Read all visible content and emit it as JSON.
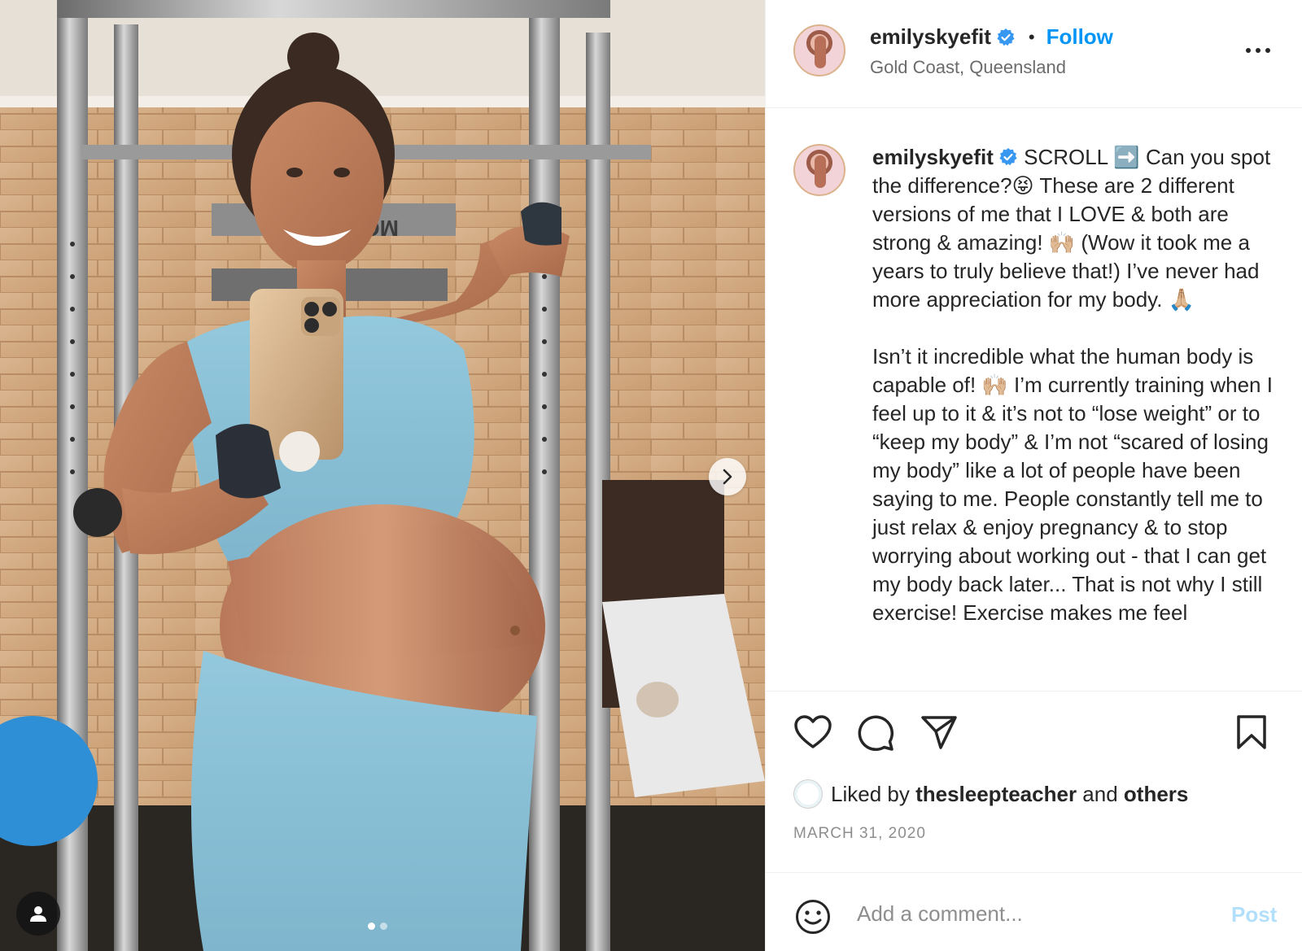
{
  "post": {
    "username": "emilyskyefit",
    "follow_label": "Follow",
    "separator": "•",
    "location": "Gold Coast, Queensland",
    "caption_username": "emilyskyefit",
    "caption": " SCROLL ➡️ Can you spot the difference?😝 These are 2 different versions of me that I LOVE & both are strong & amazing! 🙌🏼 (Wow it took me a years to truly believe that!) I’ve never had more appreciation for my body. 🙏🏼\n\nIsn’t it incredible what the human body is capable of! 🙌🏼 I’m currently training when I feel up to it & it’s not to “lose weight” or to “keep my body” & I’m not “scared of losing my body” like a lot of people have been saying to me. People constantly tell me to just relax & enjoy pregnancy & to stop worrying about working out - that I can get my body back later... That is not why I still exercise! Exercise makes me feel",
    "liked_by_prefix": "Liked by",
    "liked_by_user": "thesleepteacher",
    "liked_by_and": "and",
    "liked_by_others": "others",
    "date": "MARCH 31, 2020",
    "comment_placeholder": "Add a comment...",
    "post_label": "Post"
  },
  "media": {
    "carousel_count": 2,
    "carousel_active_index": 0,
    "equipment_brand_text": "MO"
  },
  "icons": {
    "verified": "verified-badge-icon",
    "more": "more-options-icon",
    "like": "heart-icon",
    "comment": "comment-icon",
    "share": "send-icon",
    "save": "bookmark-icon",
    "emoji": "emoji-icon",
    "next": "chevron-right-icon",
    "tag": "user-tag-icon"
  },
  "colors": {
    "accent": "#0095f6",
    "post_disabled": "#b2dffc",
    "verified_blue": "#3897f0",
    "meta_gray": "#8e8e8e"
  }
}
